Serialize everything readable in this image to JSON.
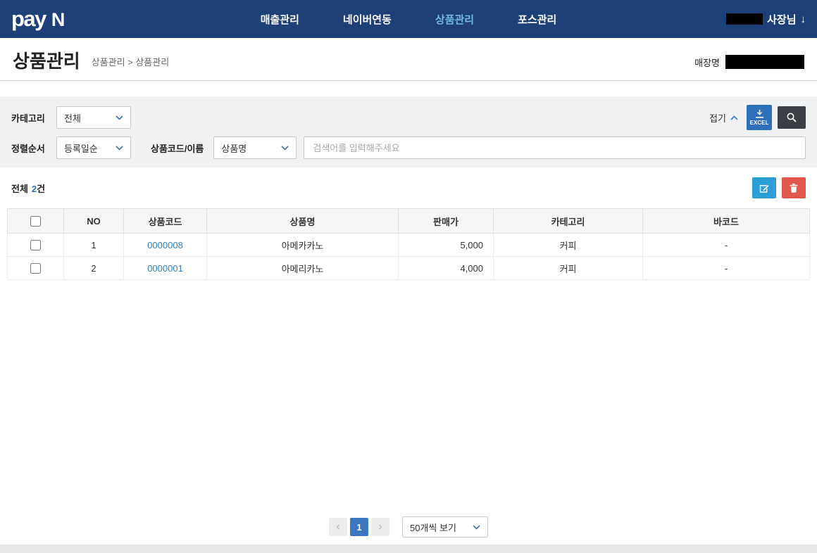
{
  "topbar": {
    "logo": {
      "pay": "pay",
      "n": "N"
    },
    "nav": [
      {
        "label": "매출관리"
      },
      {
        "label": "네이버연동"
      },
      {
        "label": "상품관리"
      },
      {
        "label": "포스관리"
      }
    ],
    "user": {
      "name": "사장님",
      "arrow": "↓"
    }
  },
  "header": {
    "title": "상품관리",
    "breadcrumb": "상품관리 > 상품관리",
    "store_label": "매장명"
  },
  "filters": {
    "category_label": "카테고리",
    "category_value": "전체",
    "sort_label": "정렬순서",
    "sort_value": "등록일순",
    "code_name_label": "상품코드/이름",
    "code_name_value": "상품명",
    "search_placeholder": "검색어를 입력해주세요",
    "collapse_label": "접기",
    "excel_label": "EXCEL"
  },
  "summary": {
    "total_label": "전체",
    "count": "2",
    "count_suffix": "건"
  },
  "table": {
    "headers": [
      "NO",
      "상품코드",
      "상품명",
      "판매가",
      "카테고리",
      "바코드"
    ],
    "rows": [
      {
        "no": "1",
        "code": "0000008",
        "name": "아메카카노",
        "price": "5,000",
        "category": "커피",
        "barcode": "-"
      },
      {
        "no": "2",
        "code": "0000001",
        "name": "아메리카노",
        "price": "4,000",
        "category": "커피",
        "barcode": "-"
      }
    ]
  },
  "pagination": {
    "prev": "‹",
    "current": "1",
    "next": "›",
    "page_size": "50개씩 보기"
  },
  "colors": {
    "topbar_bg": "#1d4078",
    "nav_active": "#6fb9e6",
    "accent_blue": "#2f6eb8",
    "link_blue": "#2f80c4",
    "edit_teal": "#2d9dd5",
    "delete_red": "#e2574c",
    "search_btn_dark": "#3a3e45",
    "filter_bg": "#f0f1f2"
  }
}
